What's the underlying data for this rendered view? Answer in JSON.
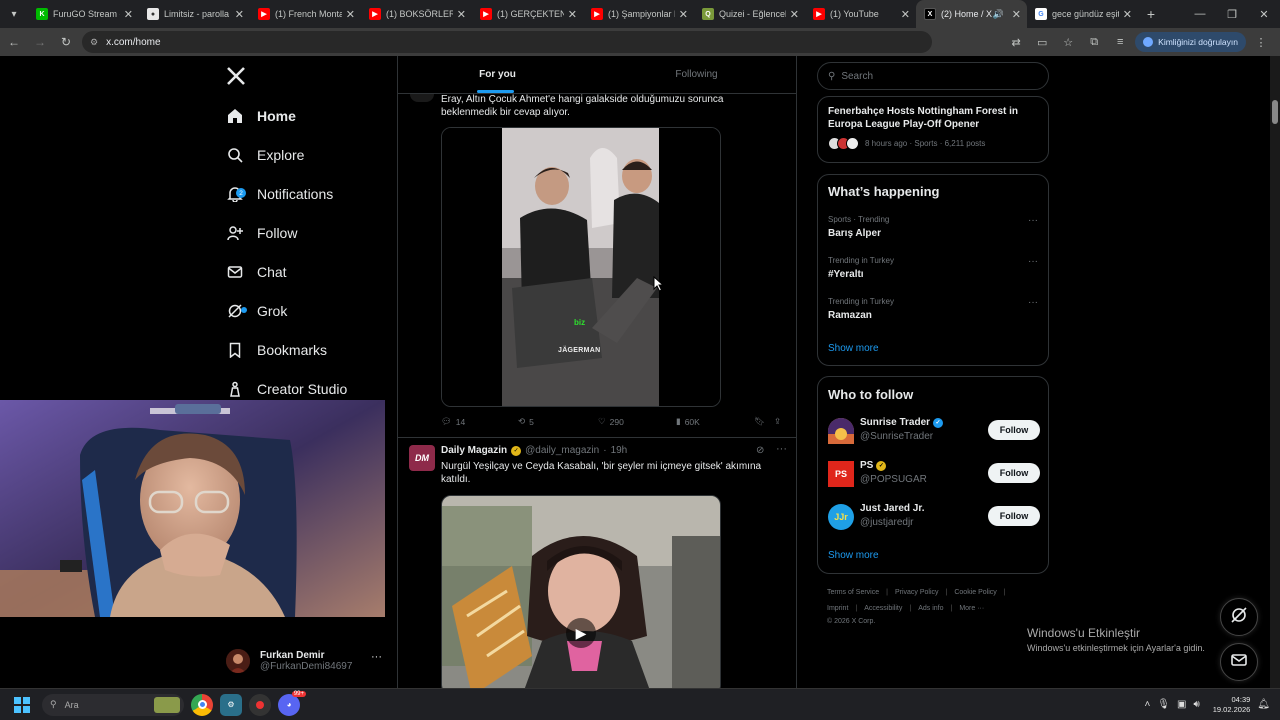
{
  "browser": {
    "tabs": [
      {
        "label": "FuruGO Stream -",
        "favicon_color": "#0b0",
        "favicon_glyph": "K"
      },
      {
        "label": "Limitsiz - parolla",
        "favicon_color": "#e8e8e8",
        "favicon_glyph": "●"
      },
      {
        "label": "(1) French Monta",
        "favicon_color": "#ff0000",
        "favicon_glyph": "▶"
      },
      {
        "label": "(1) BOKSÖRLER, F",
        "favicon_color": "#ff0000",
        "favicon_glyph": "▶"
      },
      {
        "label": "(1) GERÇEKTEN Al",
        "favicon_color": "#ff0000",
        "favicon_glyph": "▶"
      },
      {
        "label": "(1) Şampiyonlar L",
        "favicon_color": "#ff0000",
        "favicon_glyph": "▶"
      },
      {
        "label": "Quizei - Eğlenceli",
        "favicon_color": "#7a9a3a",
        "favicon_glyph": "Q"
      },
      {
        "label": "(1) YouTube",
        "favicon_color": "#ff0000",
        "favicon_glyph": "▶"
      },
      {
        "label": "(2) Home / X",
        "favicon_color": "#000000",
        "favicon_glyph": "𝕏",
        "active": true
      },
      {
        "label": "gece gündüz eşit",
        "favicon_color": "#4285f4",
        "favicon_glyph": "G"
      }
    ],
    "url": "x.com/home",
    "verify_label": "Kimliğinizi doğrulayın"
  },
  "nav": {
    "home": "Home",
    "explore": "Explore",
    "notifications": "Notifications",
    "notifications_badge": "2",
    "follow": "Follow",
    "chat": "Chat",
    "grok": "Grok",
    "bookmarks": "Bookmarks",
    "creator_studio": "Creator Studio"
  },
  "profile": {
    "name": "Furkan Demir",
    "handle": "@FurkanDemi84697"
  },
  "feed": {
    "tab_for_you": "For you",
    "tab_following": "Following",
    "tweet1": {
      "text_line1": "Eray, Altın Çocuk Ahmet'e hangi galakside olduğumuzu sorunca",
      "text_line2": "beklenmedik bir cevap alıyor.",
      "video_caption": "biz",
      "video_watermark": "JÄGERMAN",
      "replies": "14",
      "reposts": "5",
      "likes": "290",
      "views": "60K"
    },
    "tweet2": {
      "author": "Daily Magazin",
      "avatar_text": "DM",
      "handle": "@daily_magazin",
      "time": "19h",
      "text_line1": "Nurgül Yeşilçay ve Ceyda Kasabalı, 'bir şeyler mi içmeye gitsek' akımına",
      "text_line2": "katıldı."
    }
  },
  "sidebar": {
    "search_placeholder": "Search",
    "news": {
      "title_line1": "Fenerbahçe Hosts Nottingham Forest in",
      "title_line2": "Europa League Play-Off Opener",
      "meta": "8 hours ago · Sports · 6,211 posts"
    },
    "whats_happening_title": "What’s happening",
    "trends": [
      {
        "context": "Sports · Trending",
        "name": "Barış Alper"
      },
      {
        "context": "Trending in Turkey",
        "name": "#Yeraltı"
      },
      {
        "context": "Trending in Turkey",
        "name": "Ramazan"
      }
    ],
    "show_more": "Show more",
    "who_to_follow_title": "Who to follow",
    "who_to_follow": [
      {
        "name": "Sunrise Trader",
        "handle": "@SunriseTrader",
        "avatar_text": "",
        "avatar_color": "#c86a3a",
        "badge": "blue"
      },
      {
        "name": "PS",
        "handle": "@POPSUGAR",
        "avatar_text": "PS",
        "avatar_color": "#e0261b",
        "badge": "gold"
      },
      {
        "name": "Just Jared Jr.",
        "handle": "@justjaredjr",
        "avatar_text": "JJr",
        "avatar_color": "#1fa0e6",
        "badge": ""
      }
    ],
    "follow_label": "Follow",
    "show_more_2": "Show more",
    "footer_line1": [
      "Terms of Service",
      "Privacy Policy",
      "Cookie Policy"
    ],
    "footer_line2": [
      "Imprint",
      "Accessibility",
      "Ads info",
      "More ···"
    ],
    "copyright": "© 2026 X Corp."
  },
  "windows": {
    "activate_title": "Windows'u Etkinleştir",
    "activate_sub": "Windows'u etkinleştirmek için Ayarlar'a gidin.",
    "search_label": "Ara",
    "time": "04:39",
    "date": "19.02.2026",
    "discord_badge": "99+"
  },
  "colors": {
    "accent": "#1d9bf0",
    "background": "#000000",
    "border": "#2f3336",
    "muted_text": "#71767b"
  }
}
